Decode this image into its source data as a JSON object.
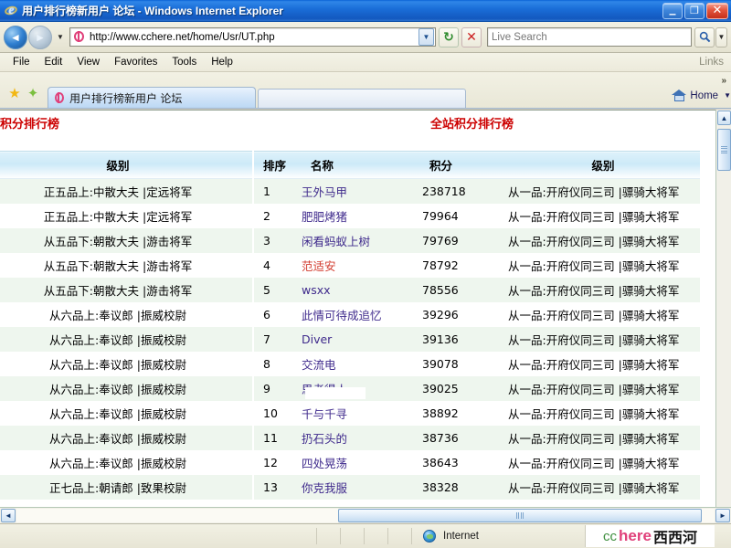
{
  "window": {
    "title": "用户排行榜新用户 论坛 - Windows Internet Explorer",
    "app_icon": "ie-logo-icon",
    "minimize_glyph": "_",
    "restore_glyph": "❐",
    "close_glyph": "✕"
  },
  "navbar": {
    "back_glyph": "◄",
    "forward_glyph": "►",
    "history_caret": "▼",
    "url": "http://www.cchere.net/home/Usr/UT.php",
    "url_dropdown_glyph": "▼",
    "refresh_glyph": "↻",
    "stop_glyph": "✕",
    "search_value": "",
    "search_placeholder": "Live Search",
    "search_caret_glyph": "▼"
  },
  "menubar": {
    "items": [
      "File",
      "Edit",
      "View",
      "Favorites",
      "Tools",
      "Help"
    ],
    "links_label": "Links"
  },
  "tabbar": {
    "favorites_star_glyph": "★",
    "add_favorite_glyph": "✦",
    "tab_label": "用户排行榜新用户 论坛",
    "home_label": "Home",
    "home_caret_glyph": "▼",
    "overflow_glyph": "»"
  },
  "page": {
    "left_title": "积分排行榜",
    "right_title": "全站积分排行榜",
    "left_headers": [
      "级别"
    ],
    "right_headers": [
      "排序",
      "名称",
      "积分",
      "级别"
    ],
    "left_rows": [
      "正五品上:中散大夫 |定远将军",
      "正五品上:中散大夫 |定远将军",
      "从五品下:朝散大夫 |游击将军",
      "从五品下:朝散大夫 |游击将军",
      "从五品下:朝散大夫 |游击将军",
      "从六品上:奉议郎 |振威校尉",
      "从六品上:奉议郎 |振威校尉",
      "从六品上:奉议郎 |振威校尉",
      "从六品上:奉议郎 |振威校尉",
      "从六品上:奉议郎 |振威校尉",
      "从六品上:奉议郎 |振威校尉",
      "从六品上:奉议郎 |振威校尉",
      "正七品上:朝请郎 |致果校尉"
    ],
    "right_rows": [
      {
        "rank": "1",
        "name": "王外马甲",
        "points": "238718",
        "level": "从一品:开府仪同三司 |骠骑大将军",
        "name_color": "purple"
      },
      {
        "rank": "2",
        "name": "肥肥烤猪",
        "points": "79964",
        "level": "从一品:开府仪同三司 |骠骑大将军",
        "name_color": "purple"
      },
      {
        "rank": "3",
        "name": "闲看蚂蚁上树",
        "points": "79769",
        "level": "从一品:开府仪同三司 |骠骑大将军",
        "name_color": "purple"
      },
      {
        "rank": "4",
        "name": "范适安",
        "points": "78792",
        "level": "从一品:开府仪同三司 |骠骑大将军",
        "name_color": "red"
      },
      {
        "rank": "5",
        "name": "wsxx",
        "points": "78556",
        "level": "从一品:开府仪同三司 |骠骑大将军",
        "name_color": "purple"
      },
      {
        "rank": "6",
        "name": "此情可待成追忆",
        "points": "39296",
        "level": "从一品:开府仪同三司 |骠骑大将军",
        "name_color": "purple"
      },
      {
        "rank": "7",
        "name": "Diver",
        "points": "39136",
        "level": "从一品:开府仪同三司 |骠骑大将军",
        "name_color": "purple"
      },
      {
        "rank": "8",
        "name": "交流电",
        "points": "39078",
        "level": "从一品:开府仪同三司 |骠骑大将军",
        "name_color": "purple"
      },
      {
        "rank": "9",
        "name": "思考得人",
        "points": "39025",
        "level": "从一品:开府仪同三司 |骠骑大将军",
        "name_color": "purple"
      },
      {
        "rank": "10",
        "name": "千与千寻",
        "points": "38892",
        "level": "从一品:开府仪同三司 |骠骑大将军",
        "name_color": "purple"
      },
      {
        "rank": "11",
        "name": "扔石头的",
        "points": "38736",
        "level": "从一品:开府仪同三司 |骠骑大将军",
        "name_color": "purple"
      },
      {
        "rank": "12",
        "name": "四处晃荡",
        "points": "38643",
        "level": "从一品:开府仪同三司 |骠骑大将军",
        "name_color": "purple"
      },
      {
        "rank": "13",
        "name": "你克我服",
        "points": "38328",
        "level": "从一品:开府仪同三司 |骠骑大将军",
        "name_color": "purple"
      }
    ]
  },
  "scrollbars": {
    "v_up_glyph": "▲",
    "v_down_glyph": "▼",
    "h_left_glyph": "◄",
    "h_right_glyph": "►"
  },
  "statusbar": {
    "zone_label": "Internet",
    "watermark": {
      "cc": "cc",
      "here": "here",
      "cn": "西西河"
    }
  },
  "colors": {
    "title_red": "#cc0000",
    "link_purple": "#3f2a8c",
    "link_red": "#d23b2e",
    "row_even": "#eef6ee",
    "row_odd": "#ffffff",
    "header_blue": "#cdeaf8",
    "chrome_tan": "#eceadb",
    "titlebar_blue": "#1b6fd9"
  }
}
